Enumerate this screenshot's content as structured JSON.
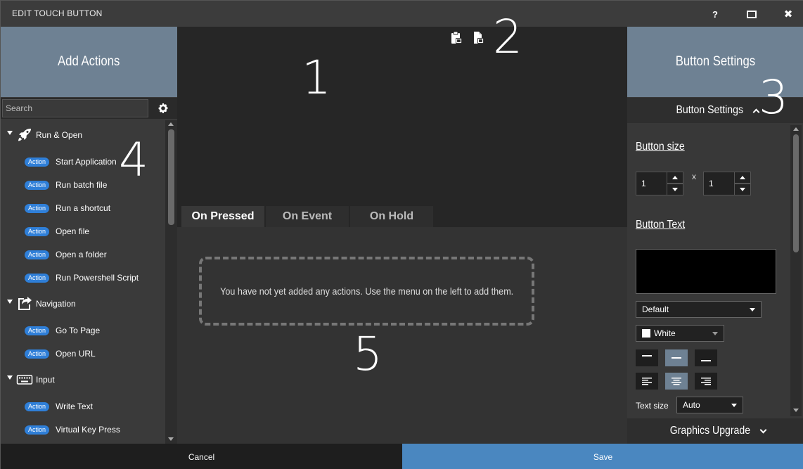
{
  "window": {
    "title": "EDIT TOUCH BUTTON",
    "help_label": "?",
    "close_label": "✖"
  },
  "left": {
    "header": "Add Actions",
    "search_placeholder": "Search",
    "badge": "Action",
    "categories": [
      {
        "label": "Run & Open",
        "icon": "rocket-icon",
        "items": [
          "Start Application",
          "Run batch file",
          "Run a shortcut",
          "Open file",
          "Open a folder",
          "Run Powershell Script"
        ]
      },
      {
        "label": "Navigation",
        "icon": "navigate-icon",
        "items": [
          "Go To Page",
          "Open URL"
        ]
      },
      {
        "label": "Input",
        "icon": "keyboard-icon",
        "items": [
          "Write Text",
          "Virtual Key Press"
        ]
      }
    ]
  },
  "center": {
    "annotations": [
      "1",
      "2",
      "3",
      "4",
      "5"
    ],
    "tabs": [
      "On Pressed",
      "On Event",
      "On Hold"
    ],
    "empty_message": "You have not yet added any actions. Use the menu on the left to add them."
  },
  "right": {
    "header": "Button Settings",
    "section_title": "Button Settings",
    "button_size_heading": "Button size",
    "size_width": "1",
    "size_height": "1",
    "size_separator": "x",
    "button_text_heading": "Button Text",
    "font_select": "Default",
    "color_select": "White",
    "text_size_label": "Text size",
    "text_size_value": "Auto",
    "graphics_section": "Graphics Upgrade"
  },
  "footer": {
    "cancel": "Cancel",
    "save": "Save"
  }
}
